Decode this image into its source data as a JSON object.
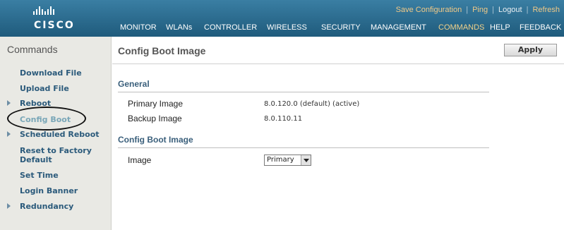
{
  "header": {
    "logo_text": "CISCO",
    "top_links": [
      "Save Configuration",
      "Ping",
      "Logout",
      "Refresh"
    ],
    "nav": [
      "MONITOR",
      "WLANs",
      "CONTROLLER",
      "WIRELESS",
      "SECURITY",
      "MANAGEMENT",
      "COMMANDS",
      "HELP",
      "FEEDBACK"
    ],
    "active_nav": "COMMANDS"
  },
  "sidebar": {
    "title": "Commands",
    "items": [
      {
        "label": "Download File",
        "arrow": false
      },
      {
        "label": "Upload File",
        "arrow": false
      },
      {
        "label": "Reboot",
        "arrow": true
      },
      {
        "label": "Config Boot",
        "arrow": false,
        "active": true
      },
      {
        "label": "Scheduled Reboot",
        "arrow": true
      },
      {
        "label": "Reset to Factory",
        "arrow": false
      },
      {
        "label": "Default",
        "arrow": false
      },
      {
        "label": "Set Time",
        "arrow": false
      },
      {
        "label": "Login Banner",
        "arrow": false
      },
      {
        "label": "Redundancy",
        "arrow": true
      }
    ]
  },
  "main": {
    "title": "Config Boot Image",
    "apply_label": "Apply",
    "general_heading": "General",
    "primary_label": "Primary Image",
    "primary_value": "8.0.120.0 (default) (active)",
    "backup_label": "Backup Image",
    "backup_value": "8.0.110.11",
    "config_heading": "Config Boot Image",
    "image_label": "Image",
    "image_selected": "Primary"
  },
  "colors": {
    "header_bg": "#2b6c8e",
    "nav_active": "#f2d28a",
    "sidebar_bg": "#e9e9e4",
    "sidebar_link": "#2b5a7b"
  }
}
